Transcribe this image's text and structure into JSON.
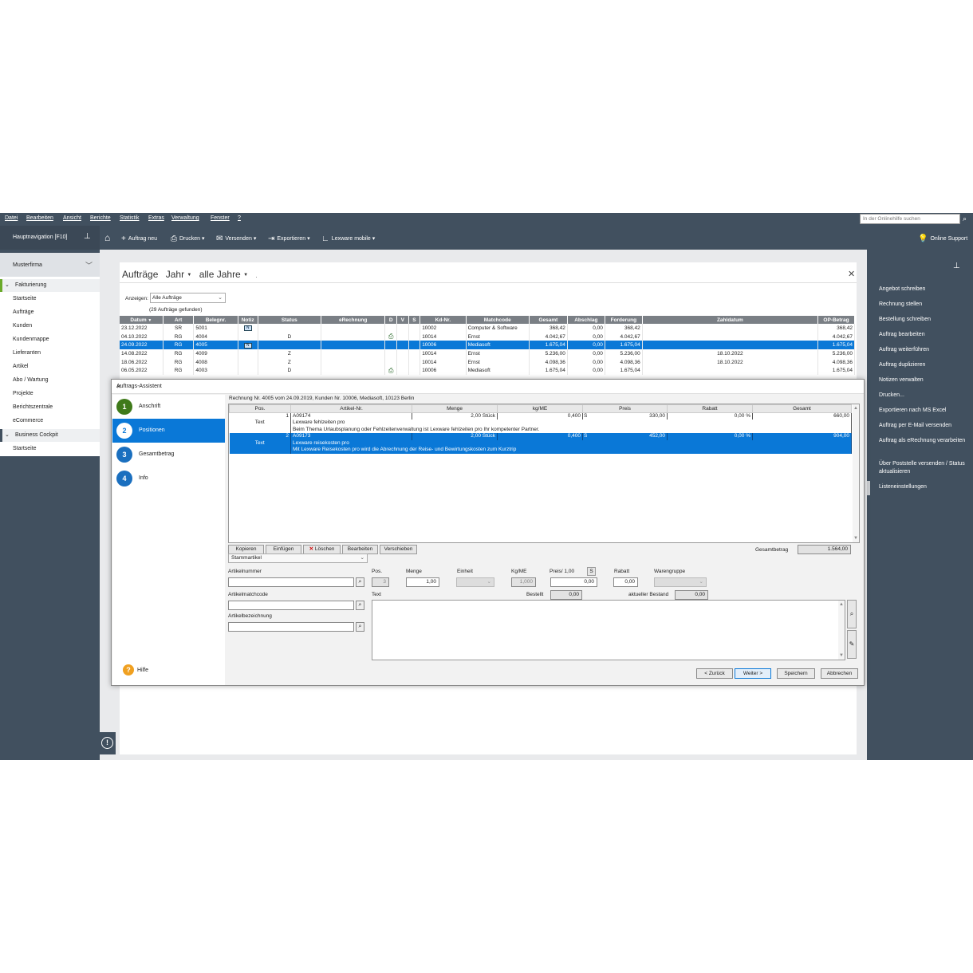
{
  "menu": [
    "Datei",
    "Bearbeiten",
    "Ansicht",
    "Berichte",
    "Statistik",
    "Extras",
    "Verwaltung",
    "Fenster",
    "?"
  ],
  "help_search": {
    "placeholder": "In der Onlinehilfe suchen"
  },
  "toolbar": {
    "nav_label": "Hauptnavigation [F10]",
    "new_order": "Auftrag neu",
    "print": "Drucken",
    "send": "Versenden",
    "export": "Exportieren",
    "mobile": "Lexware mobile",
    "support": "Online Support"
  },
  "leftnav": {
    "company": "Musterfirma",
    "group1": "Fakturierung",
    "items1": [
      "Startseite",
      "Aufträge",
      "Kunden",
      "Kundenmappe",
      "Lieferanten",
      "Artikel",
      "Abo / Wartung",
      "Projekte",
      "Berichtszentrale",
      "eCommerce"
    ],
    "group2": "Business Cockpit",
    "items2": [
      "Startseite"
    ]
  },
  "rightpanel": {
    "items": [
      "Angebot schreiben",
      "Rechnung stellen",
      "Bestellung schreiben",
      "Auftrag bearbeiten",
      "Auftrag weiterführen",
      "Auftrag duplizieren",
      "Notizen verwalten",
      "Drucken...",
      "Exportieren nach MS Excel",
      "Auftrag per E-Mail versenden",
      "Auftrag als eRechnung verarbeiten",
      "Über Poststelle versenden / Status aktualisieren",
      "Listeneinstellungen"
    ]
  },
  "main": {
    "title": "Aufträge",
    "period": "Jahr",
    "years": "alle Jahre",
    "dot": ".",
    "show_label": "Anzeigen:",
    "show_value": "Alle Aufträge",
    "found": "(29 Aufträge gefunden)",
    "columns": [
      "Datum",
      "Art",
      "Belegnr.",
      "Notiz",
      "Status",
      "eRechnung",
      "D",
      "V",
      "S",
      "Kd-Nr.",
      "Matchcode",
      "Gesamt",
      "Abschlag",
      "Forderung",
      "Zahldatum",
      "OP-Betrag"
    ],
    "rows": [
      {
        "datum": "23.12.2022",
        "art": "SR",
        "beleg": "5001",
        "status": "",
        "kd": "10002",
        "match": "Computer & Software",
        "gesamt": "368,42",
        "abschlag": "0,00",
        "forderung": "368,42",
        "zahl": "",
        "op": "368,42"
      },
      {
        "datum": "04.10.2022",
        "art": "RG",
        "beleg": "4004",
        "status": "D",
        "kd": "10014",
        "match": "Ernst",
        "gesamt": "4.042,67",
        "abschlag": "0,00",
        "forderung": "4.042,67",
        "zahl": "",
        "op": "4.042,67"
      },
      {
        "datum": "24.09.2022",
        "art": "RG",
        "beleg": "4005",
        "status": "",
        "kd": "10006",
        "match": "Mediasoft",
        "gesamt": "1.675,04",
        "abschlag": "0,00",
        "forderung": "1.675,04",
        "zahl": "",
        "op": "1.675,04"
      },
      {
        "datum": "14.08.2022",
        "art": "RG",
        "beleg": "4009",
        "status": "Z",
        "kd": "10014",
        "match": "Ernst",
        "gesamt": "5.236,00",
        "abschlag": "0,00",
        "forderung": "5.236,00",
        "zahl": "18.10.2022",
        "op": "5.236,00"
      },
      {
        "datum": "18.06.2022",
        "art": "RG",
        "beleg": "4008",
        "status": "Z",
        "kd": "10014",
        "match": "Ernst",
        "gesamt": "4.098,36",
        "abschlag": "0,00",
        "forderung": "4.098,36",
        "zahl": "18.10.2022",
        "op": "4.098,36"
      },
      {
        "datum": "06.05.2022",
        "art": "RG",
        "beleg": "4003",
        "status": "D",
        "kd": "10006",
        "match": "Mediasoft",
        "gesamt": "1.675,04",
        "abschlag": "0,00",
        "forderung": "1.675,04",
        "zahl": "",
        "op": "1.675,04"
      }
    ]
  },
  "dialog": {
    "title": "Auftrags-Assistent",
    "steps": [
      {
        "num": "1",
        "label": "Anschrift"
      },
      {
        "num": "2",
        "label": "Positionen"
      },
      {
        "num": "3",
        "label": "Gesamtbetrag"
      },
      {
        "num": "4",
        "label": "Info"
      }
    ],
    "header": "Rechnung Nr. 4005 vom 24.09.2019, Kunden Nr. 10006, Mediasoft, 10123 Berlin",
    "pos_columns": [
      "Pos.",
      "Artikel-Nr.",
      "Menge",
      "kg/ME",
      "Preis",
      "Rabatt",
      "Gesamt"
    ],
    "positions": [
      {
        "pos": "1",
        "artikel": "A09174",
        "menge": "2,00 Stück",
        "kg": "0,400",
        "s": "S",
        "preis": "330,00",
        "rabatt": "0,00 %",
        "gesamt": "660,00",
        "text_label": "Text",
        "text1": "Lexware fehlzeiten pro",
        "text2": "Beim Thema Urlaubsplanung oder Fehlzeitenverwaltung ist Lexware fehlzeiten pro Ihr kompetenter Partner."
      },
      {
        "pos": "2",
        "artikel": "A09173",
        "menge": "2,00 Stück",
        "kg": "0,400",
        "s": "S",
        "preis": "452,00",
        "rabatt": "0,00 %",
        "gesamt": "904,00",
        "text_label": "Text",
        "text1": "Lexware reisekosten pro",
        "text2": "Mit Lexware Reisekosten pro wird die Abrechnung der Reise- und Bewirtungskosten zum Kurztrip"
      }
    ],
    "buttons": {
      "copy": "Kopieren",
      "paste": "Einfügen",
      "delete": "Löschen",
      "edit": "Bearbeiten",
      "move": "Verschieben"
    },
    "total_label": "Gesamtbetrag",
    "total_value": "1.564,00",
    "stamm": "Stammartikel",
    "labels": {
      "artnr": "Artikelnummer",
      "pos": "Pos.",
      "menge": "Menge",
      "einheit": "Einheit",
      "kgme": "Kg/ME",
      "preis": "Preis/ 1,00",
      "s": "S",
      "rabatt": "Rabatt",
      "warengruppe": "Warengruppe",
      "match": "Artikelmatchcode",
      "text": "Text",
      "bestellt": "Bestellt",
      "bestand": "aktueller Bestand",
      "bez": "Artikelbezeichnung"
    },
    "values": {
      "pos": "3",
      "menge": "1,00",
      "kgme": "1,000",
      "preis": "0,00",
      "rabatt": "0,00",
      "bestellt": "0,00",
      "bestand": "0,00"
    },
    "help": "Hilfe",
    "nav": {
      "back": "< Zurück",
      "next": "Weiter >",
      "save": "Speichern",
      "cancel": "Abbrechen"
    }
  }
}
